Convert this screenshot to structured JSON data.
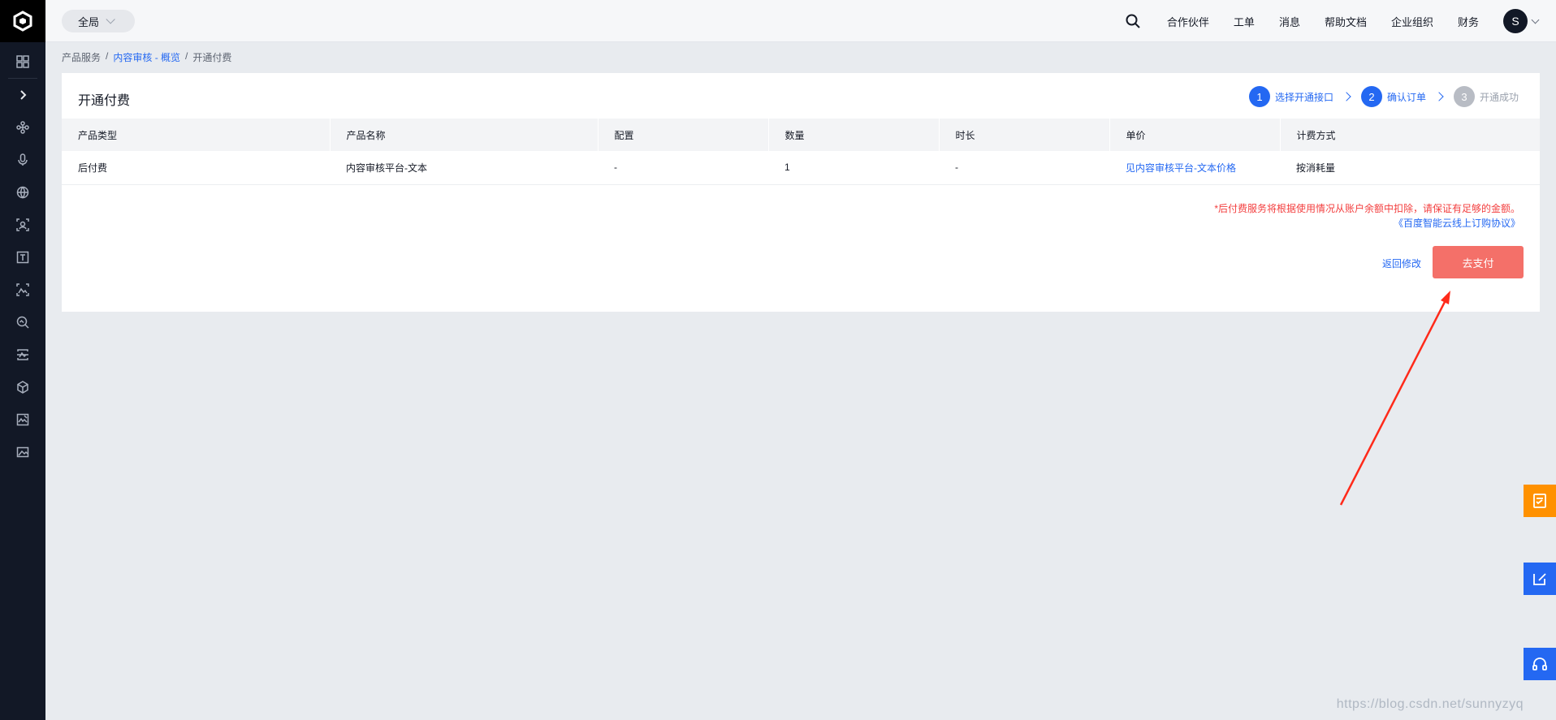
{
  "topbar": {
    "region_label": "全局",
    "nav": [
      "合作伙伴",
      "工单",
      "消息",
      "帮助文档",
      "企业组织",
      "财务"
    ],
    "avatar_initial": "S"
  },
  "breadcrumb": {
    "root": "产品服务",
    "sep": "/",
    "parent": "内容审核 - 概览",
    "current": "开通付费"
  },
  "card": {
    "title": "开通付费",
    "steps": [
      {
        "num": "1",
        "label": "选择开通接口",
        "state": "done"
      },
      {
        "num": "2",
        "label": "确认订单",
        "state": "active"
      },
      {
        "num": "3",
        "label": "开通成功",
        "state": "todo"
      }
    ]
  },
  "table": {
    "headers": [
      "产品类型",
      "产品名称",
      "配置",
      "数量",
      "时长",
      "单价",
      "计费方式"
    ],
    "rows": [
      [
        "后付费",
        "内容审核平台-文本",
        "-",
        "1",
        "-",
        "见内容审核平台-文本价格",
        "按消耗量"
      ]
    ]
  },
  "notice": {
    "warning": "*后付费服务将根据使用情况从账户余额中扣除，请保证有足够的金额。",
    "agreement": "《百度智能云线上订购协议》"
  },
  "actions": {
    "back_label": "返回修改",
    "pay_label": "去支付"
  },
  "colors": {
    "sidebar": "#121826",
    "primary": "#2468f2",
    "pay_button": "#f47069",
    "warning": "#f33e3e",
    "float_orange": "#ff9100",
    "float_blue": "#2468f2",
    "annotation_arrow": "#ff2a1a"
  },
  "sidebar_icons": [
    "grid-icon",
    "expand-icon",
    "network-icon",
    "microphone-icon",
    "globe-icon",
    "face-scan-icon",
    "text-recognition-icon",
    "image-face-icon",
    "image-search-icon",
    "image-scan-icon",
    "cube-icon",
    "image-edit-icon",
    "image-icon"
  ],
  "float_icons": [
    "survey-icon",
    "feedback-edit-icon",
    "headset-icon"
  ],
  "watermark": "https://blog.csdn.net/sunnyzyq"
}
